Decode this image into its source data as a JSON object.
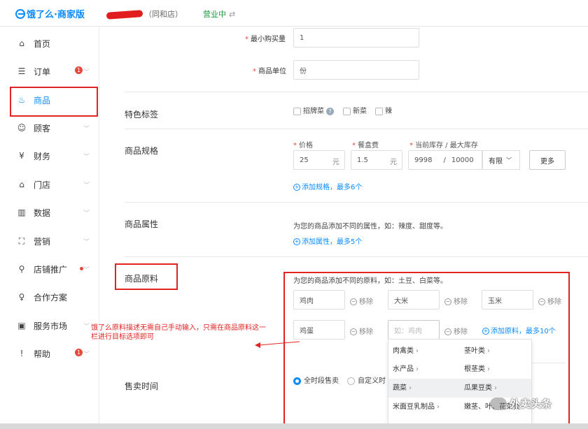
{
  "header": {
    "logo_text": "饿了么·商家版",
    "shop_name": "（同和店）",
    "status": "营业中",
    "swap_glyph": "⇄"
  },
  "sidebar": {
    "items": [
      {
        "label": "首页",
        "icon": "home-icon",
        "glyph": "⌂"
      },
      {
        "label": "订单",
        "icon": "order-icon",
        "glyph": "☰",
        "badge": "1"
      },
      {
        "label": "商品",
        "icon": "product-icon",
        "glyph": "♨"
      },
      {
        "label": "顾客",
        "icon": "customer-icon",
        "glyph": "☺"
      },
      {
        "label": "财务",
        "icon": "finance-icon",
        "glyph": "¥"
      },
      {
        "label": "门店",
        "icon": "store-icon",
        "glyph": "⌂"
      },
      {
        "label": "数据",
        "icon": "data-icon",
        "glyph": "▥"
      },
      {
        "label": "营销",
        "icon": "marketing-icon",
        "glyph": "⛶"
      },
      {
        "label": "店铺推广",
        "icon": "promote-icon",
        "glyph": "⚲"
      },
      {
        "label": "合作方案",
        "icon": "bulb-icon",
        "glyph": "♀"
      },
      {
        "label": "服务市场",
        "icon": "market-icon",
        "glyph": "▣"
      },
      {
        "label": "帮助",
        "icon": "help-icon",
        "glyph": "!",
        "badge": "1"
      }
    ]
  },
  "form": {
    "min_qty": {
      "label": "最小购买量",
      "value": "1"
    },
    "unit": {
      "label": "商品单位",
      "value": "份"
    },
    "tags": {
      "label": "特色标签",
      "options": [
        "招牌菜",
        "新菜",
        "辣"
      ]
    },
    "spec": {
      "label": "商品规格",
      "price_label": "价格",
      "price_value": "25",
      "price_unit": "元",
      "box_label": "餐盒费",
      "box_value": "1.5",
      "box_unit": "元",
      "stock_label": "当前库存 / 最大库存",
      "stock_current": "9998",
      "stock_sep": "/",
      "stock_max": "10000",
      "limit_select": "有限",
      "more_button": "更多",
      "add_spec_link": "添加规格，最多6个"
    },
    "attr": {
      "label": "商品属性",
      "desc": "为您的商品添加不同的属性，如：辣度、甜度等。",
      "add_link": "添加属性，最多5个"
    },
    "material": {
      "label": "商品原料",
      "desc": "为您的商品添加不同的原料，如：土豆、白菜等。",
      "items": [
        "鸡肉",
        "大米",
        "玉米",
        "鸡蛋"
      ],
      "remove_label": "移除",
      "new_placeholder": "如：鸡肉",
      "add_link": "添加原料，最多10个"
    },
    "sale_time": {
      "label": "售卖时间",
      "opt_all": "全时段售卖",
      "opt_custom": "自定义时"
    }
  },
  "dropdown": {
    "left": [
      "肉禽类",
      "水产品",
      "蔬菜",
      "米面豆乳制品"
    ],
    "right": [
      "茎叶类",
      "根茎类",
      "瓜果豆类",
      "嫩茎、叶、花菜类"
    ]
  },
  "annotation": "饿了么原料描述无需自己手动输入，只需在商品原料这一栏进行目标选项即可",
  "watermark": "外卖头条",
  "colors": {
    "accent": "#0a8cff",
    "highlight": "#e02424",
    "status": "#1a9a3c"
  }
}
